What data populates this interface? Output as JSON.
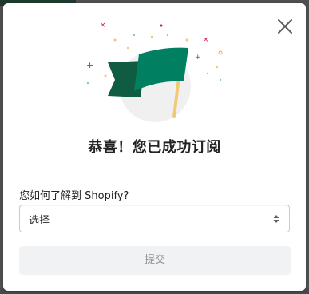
{
  "modal": {
    "title": "恭喜！您已成功订阅",
    "close_icon": "close-icon",
    "illustration_icon": "flag-celebration-illustration",
    "colors": {
      "flag_dark": "#0f5c43",
      "flag_light": "#008060",
      "pole": "#f2c879",
      "circle": "#f0f0f0"
    }
  },
  "form": {
    "question_label": "您如何了解到 Shopify?",
    "select": {
      "selected_value": "选择",
      "arrow_icon": "select-arrows-icon"
    },
    "submit_label": "提交"
  }
}
